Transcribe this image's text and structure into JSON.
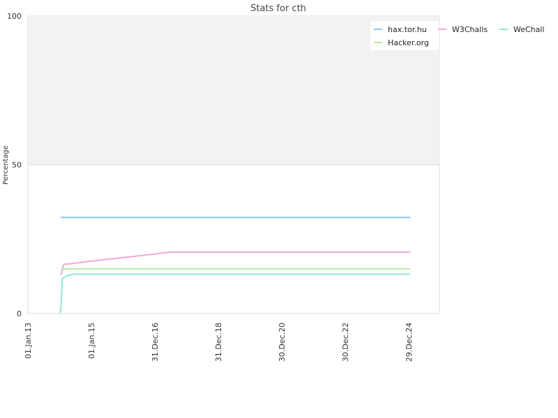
{
  "chart_data": {
    "type": "line",
    "title": "Stats for cth",
    "xlabel": "",
    "ylabel": "Percentage",
    "ylim": [
      0,
      100
    ],
    "yticks": [
      0,
      50,
      100
    ],
    "xticks": [
      "01.Jan.13",
      "01.Jan.15",
      "31.Dec.16",
      "31.Dec.18",
      "30.Dec.20",
      "30.Dec.22",
      "29.Dec.24"
    ],
    "legend_position": "top-right",
    "shaded_band": [
      50,
      100
    ],
    "colors": {
      "shade": "#f2f2f2",
      "grid": "#dddddd"
    },
    "series": [
      {
        "name": "hax.tor.hu",
        "color": "#8ec6ee",
        "points": [
          [
            "2014-01-15",
            32.3
          ],
          [
            "2025-01-15",
            32.3
          ]
        ]
      },
      {
        "name": "W3Challs",
        "color": "#f0a8d2",
        "points": [
          [
            "2014-01-15",
            13.0
          ],
          [
            "2014-02-15",
            16.3
          ],
          [
            "2014-03-01",
            16.6
          ],
          [
            "2014-06-01",
            16.8
          ],
          [
            "2015-01-01",
            17.6
          ],
          [
            "2016-01-01",
            18.8
          ],
          [
            "2017-01-01",
            20.0
          ],
          [
            "2017-06-01",
            20.6
          ],
          [
            "2025-01-15",
            20.6
          ]
        ]
      },
      {
        "name": "WeChall",
        "color": "#8ee6d6",
        "points": [
          [
            "2014-01-10",
            0.0
          ],
          [
            "2014-01-20",
            4.0
          ],
          [
            "2014-02-01",
            11.8
          ],
          [
            "2014-04-01",
            12.8
          ],
          [
            "2014-06-01",
            13.2
          ],
          [
            "2025-01-15",
            13.2
          ]
        ]
      },
      {
        "name": "Hacker.org",
        "color": "#b6eaa6",
        "points": [
          [
            "2014-01-15",
            14.2
          ],
          [
            "2014-03-01",
            15.0
          ],
          [
            "2025-01-15",
            15.0
          ]
        ]
      }
    ]
  }
}
